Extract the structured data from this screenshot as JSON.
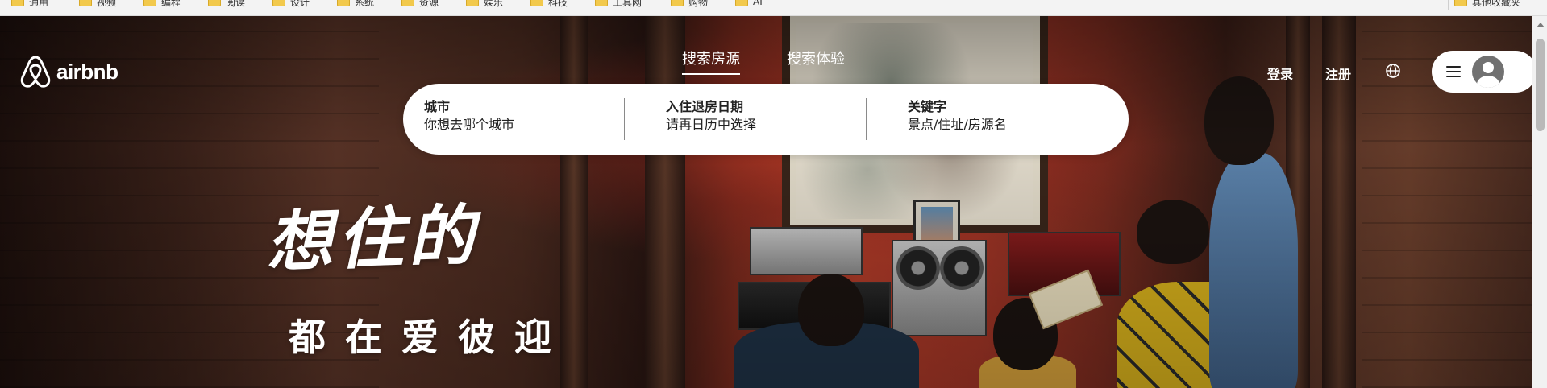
{
  "bookmarks": {
    "items": [
      {
        "label": "通用",
        "icon": "folder-icon"
      },
      {
        "label": "视频",
        "icon": "folder-icon"
      },
      {
        "label": "编程",
        "icon": "folder-icon"
      },
      {
        "label": "阅读",
        "icon": "folder-icon"
      },
      {
        "label": "设计",
        "icon": "folder-icon"
      },
      {
        "label": "系统",
        "icon": "folder-icon"
      },
      {
        "label": "资源",
        "icon": "folder-icon"
      },
      {
        "label": "娱乐",
        "icon": "folder-icon"
      },
      {
        "label": "科技",
        "icon": "folder-icon"
      },
      {
        "label": "工具网",
        "icon": "folder-icon"
      },
      {
        "label": "购物",
        "icon": "folder-icon"
      },
      {
        "label": "AI",
        "icon": "folder-icon"
      }
    ],
    "other": {
      "label": "其他收藏夹",
      "icon": "folder-icon"
    }
  },
  "header": {
    "logo_text": "airbnb",
    "logo_icon": "airbnb-belo-icon",
    "tabs": [
      {
        "label": "搜索房源",
        "active": true
      },
      {
        "label": "搜索体验",
        "active": false
      }
    ],
    "login_label": "登录",
    "signup_label": "注册",
    "language_icon": "globe-icon",
    "menu_icon": "hamburger-menu-icon",
    "avatar_icon": "user-avatar-icon"
  },
  "search": {
    "fields": [
      {
        "label": "城市",
        "value": "你想去哪个城市"
      },
      {
        "label": "入住退房日期",
        "value": "请再日历中选择"
      },
      {
        "label": "关键字",
        "value": "景点/住址/房源名"
      }
    ]
  },
  "hero": {
    "slogan_main": "想住的",
    "slogan_sub": "都在爱彼迎"
  },
  "colors": {
    "brand_text": "#ffffff",
    "search_bg": "#ffffff",
    "text_dark": "#222222"
  }
}
